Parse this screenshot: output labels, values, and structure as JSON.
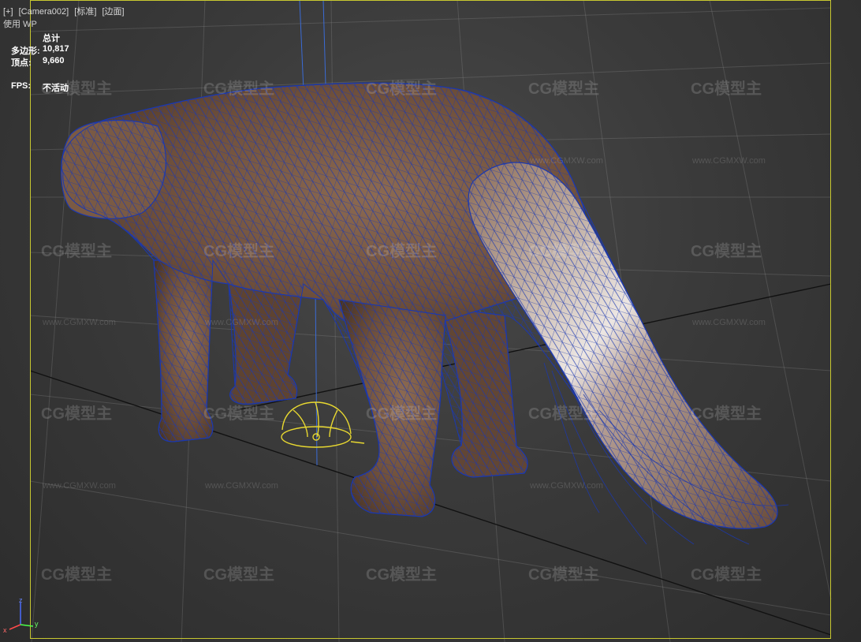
{
  "viewport": {
    "label_items": [
      "[+]",
      "[Camera002]",
      "[标准]",
      "[边面]"
    ],
    "sub_label": "使用 WP"
  },
  "stats": {
    "header": "总计",
    "polygons_label": "多边形:",
    "polygons_value": "10,817",
    "vertices_label": "顶点:",
    "vertices_value": "9,660",
    "fps_label": "FPS:",
    "fps_value": "不活动"
  },
  "watermark": {
    "logo_text": "CG模型主",
    "url_text": "www.CGMXW.com"
  },
  "axis_gizmo": {
    "z": "z",
    "x": "x",
    "y": "y"
  },
  "colors": {
    "safe_frame": "#c8c830",
    "wire": "#1e3aa8",
    "fur": "#7a5a44",
    "grid": "#151515",
    "light_gizmo": "#e8d830"
  }
}
